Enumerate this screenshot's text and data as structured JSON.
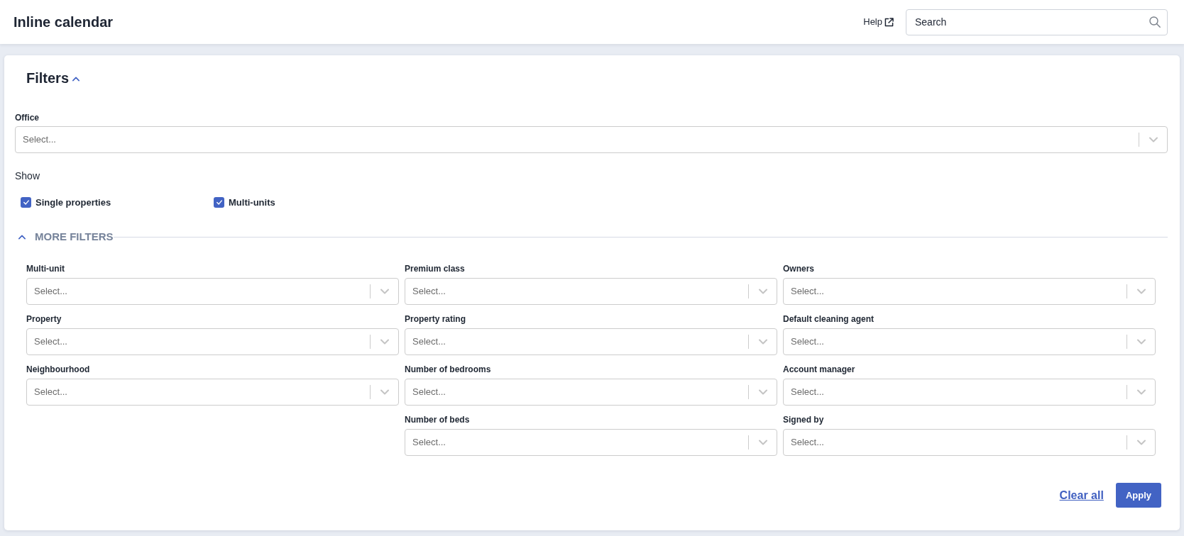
{
  "header": {
    "title": "Inline calendar",
    "help_link": "Help",
    "search": {
      "placeholder": "Search"
    }
  },
  "filters": {
    "title": "Filters",
    "expanded": true,
    "office": {
      "label": "Office",
      "placeholder": "Select..."
    },
    "show": {
      "label": "Show",
      "options": [
        {
          "label": "Single properties",
          "checked": true
        },
        {
          "label": "Multi-units",
          "checked": true
        }
      ]
    },
    "more_filters": {
      "title": "MORE FILTERS",
      "expanded": true,
      "columns": [
        [
          {
            "label": "Multi-unit",
            "placeholder": "Select..."
          },
          {
            "label": "Property",
            "placeholder": "Select..."
          },
          {
            "label": "Neighbourhood",
            "placeholder": "Select..."
          }
        ],
        [
          {
            "label": "Premium class",
            "placeholder": "Select..."
          },
          {
            "label": "Property rating",
            "placeholder": "Select..."
          },
          {
            "label": "Number of bedrooms",
            "placeholder": "Select..."
          },
          {
            "label": "Number of beds",
            "placeholder": "Select..."
          }
        ],
        [
          {
            "label": "Owners",
            "placeholder": "Select..."
          },
          {
            "label": "Default cleaning agent",
            "placeholder": "Select..."
          },
          {
            "label": "Account manager",
            "placeholder": "Select..."
          },
          {
            "label": "Signed by",
            "placeholder": "Select..."
          }
        ]
      ]
    },
    "actions": {
      "clear": "Clear all",
      "apply": "Apply"
    }
  }
}
